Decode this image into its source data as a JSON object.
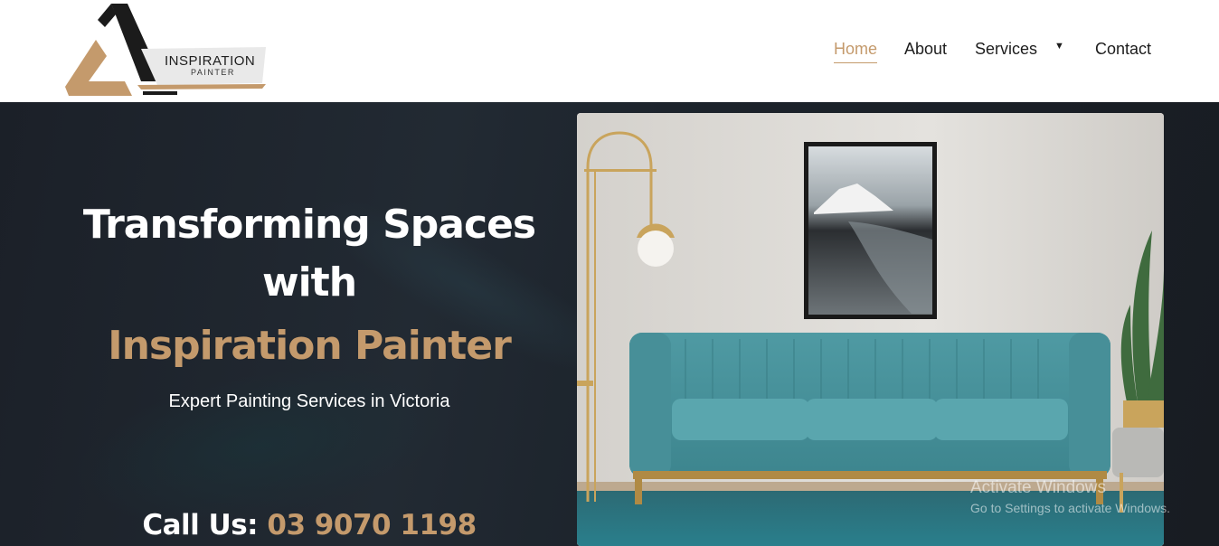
{
  "brand": {
    "name": "INSPIRATION",
    "tagline": "PAINTER",
    "colors": {
      "accent": "#c49a6c",
      "dark": "#1b1b1b",
      "hero_bg": "#1c232b"
    }
  },
  "nav": {
    "items": [
      {
        "label": "Home",
        "active": true
      },
      {
        "label": "About",
        "active": false
      },
      {
        "label": "Services",
        "active": false,
        "has_dropdown": true
      },
      {
        "label": "Contact",
        "active": false
      }
    ],
    "dropdown_icon": "caret-down-icon"
  },
  "hero": {
    "headline_line_1": "Transforming Spaces",
    "headline_line_2": "with",
    "headline_line_3": "Inspiration Painter",
    "subtitle": "Expert Painting Services in Victoria",
    "call_label": "Call Us:",
    "phone": "03 9070 1198"
  },
  "watermark": {
    "title": "Activate Windows",
    "subtitle": "Go to Settings to activate Windows."
  }
}
